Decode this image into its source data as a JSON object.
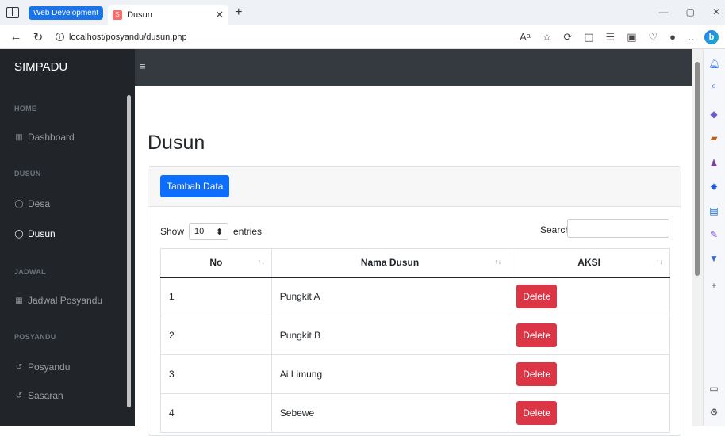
{
  "browser": {
    "tab_group_label": "Web Development",
    "tab_title": "Dusun",
    "url": "localhost/posyandu/dusun.php",
    "new_tab": "+"
  },
  "app": {
    "brand": "SIMPADU",
    "toggle_icon": "hamburger-icon"
  },
  "sidebar": {
    "sections": [
      {
        "heading": "HOME",
        "items": [
          {
            "label": "Dashboard",
            "icon": "building-icon",
            "active": false
          }
        ]
      },
      {
        "heading": "DUSUN",
        "items": [
          {
            "label": "Desa",
            "icon": "circle-icon",
            "active": false
          },
          {
            "label": "Dusun",
            "icon": "circle-icon",
            "active": true
          }
        ]
      },
      {
        "heading": "JADWAL",
        "items": [
          {
            "label": "Jadwal Posyandu",
            "icon": "calendar-icon",
            "active": false
          }
        ]
      },
      {
        "heading": "POSYANDU",
        "items": [
          {
            "label": "Posyandu",
            "icon": "stethoscope-icon",
            "active": false
          },
          {
            "label": "Sasaran",
            "icon": "stethoscope-icon",
            "active": false
          }
        ]
      }
    ]
  },
  "main": {
    "page_title": "Dusun",
    "add_button": "Tambah Data",
    "show_label": "Show",
    "entries_value": "10",
    "entries_label": "entries",
    "search_label": "Search:",
    "search_value": "",
    "table": {
      "headers": [
        "No",
        "Nama Dusun",
        "AKSI"
      ],
      "rows": [
        {
          "no": "1",
          "nama": "Pungkit A",
          "action": "Delete"
        },
        {
          "no": "2",
          "nama": "Pungkit B",
          "action": "Delete"
        },
        {
          "no": "3",
          "nama": "Ai Limung",
          "action": "Delete"
        },
        {
          "no": "4",
          "nama": "Sebewe",
          "action": "Delete"
        }
      ]
    }
  },
  "colors": {
    "sidebar_bg": "#212529",
    "topbar_bg": "#343a40",
    "primary": "#0d6efd",
    "danger": "#dc3545"
  }
}
